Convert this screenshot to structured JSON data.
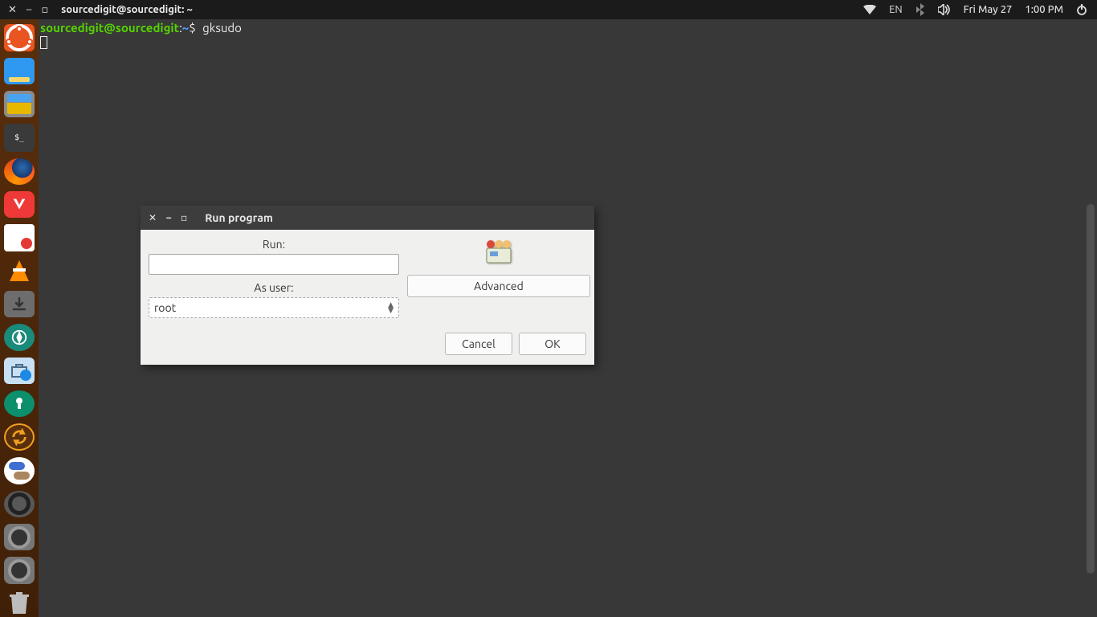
{
  "panel": {
    "window_title": "sourcedigit@sourcedigit: ~",
    "lang": "EN",
    "date": "Fri May 27",
    "time": "1:00 PM"
  },
  "terminal": {
    "prompt_user": "sourcedigit",
    "prompt_at": "@",
    "prompt_host": "sourcedigit",
    "prompt_colon": ":",
    "prompt_path": "~",
    "prompt_dollar": "$",
    "command": "gksudo"
  },
  "dialog": {
    "title": "Run program",
    "run_label": "Run:",
    "run_value": "",
    "user_label": "As user:",
    "user_value": "root",
    "advanced": "Advanced",
    "cancel": "Cancel",
    "ok": "OK"
  },
  "launcher": {
    "terminal_prompt": "$_"
  }
}
